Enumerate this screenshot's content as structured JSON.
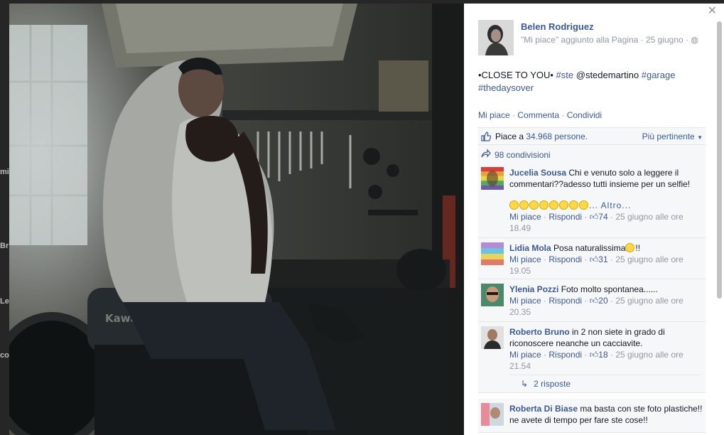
{
  "backdrop": {
    "edge_labels": [
      "mi",
      "Br",
      "Le",
      "co"
    ]
  },
  "post": {
    "author": "Belen Rodriguez",
    "meta": "\"Mi piace\" aggiunto alla Pagina · 25 giugno ·",
    "text_prefix": "•CLOSE TO YOU•",
    "hashtag_ste": "#ste",
    "mention": "@stedemartino",
    "hashtag_garage": "#garage",
    "hashtag_thedaysover": "#thedaysover",
    "actions": {
      "like": "Mi piace",
      "sep": " · ",
      "comment": "Commenta",
      "share": "Condividi"
    },
    "likes_prefix": "Piace a",
    "likes_count": "34.968 persone.",
    "sort_label": "Più pertinente",
    "shares": "98 condivisioni"
  },
  "comments": [
    {
      "name": "Jucelia Sousa",
      "text": "Chi e venuto solo a leggere il commentari??adesso tutti insieme per un selfie!",
      "more": "... Altro...",
      "like": "Mi piace",
      "reply": "Rispondi",
      "count": "74",
      "date": "25 giugno alle ore 18.49"
    },
    {
      "name": "Lidia Mola",
      "text": "Posa naturalissima",
      "suffix": "!!",
      "like": "Mi piace",
      "reply": "Rispondi",
      "count": "31",
      "date": "25 giugno alle ore 19.05"
    },
    {
      "name": "Ylenia Pozzi",
      "text": "Foto molto spontanea......",
      "like": "Mi piace",
      "reply": "Rispondi",
      "count": "20",
      "date": "25 giugno alle ore 20.35"
    },
    {
      "name": "Roberto Bruno",
      "text": "in 2 non siete in grado di riconoscere neanche un cacciavite.",
      "like": "Mi piace",
      "reply": "Rispondi",
      "count": "18",
      "date": "25 giugno alle ore 21.54",
      "replies": "2 risposte"
    },
    {
      "name": "Roberta Di Biase",
      "text": "ma basta con ste foto plastiche!! ne avete di tempo per fare ste cose!!"
    }
  ],
  "photo": {
    "brand": "Kawasaki"
  },
  "colors": {
    "link": "#3b5998",
    "meta": "#9197a3",
    "panel": "#f6f7f8"
  }
}
